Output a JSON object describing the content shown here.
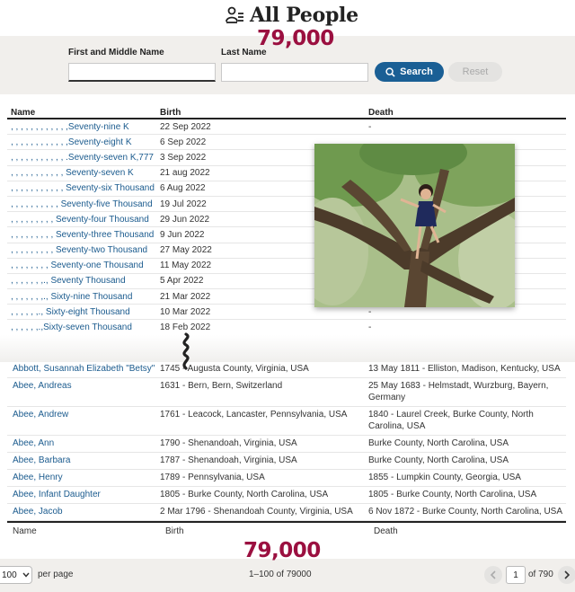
{
  "header": {
    "title": "All People"
  },
  "overlay_counts": {
    "top": "79,000",
    "bottom": "79,000"
  },
  "search": {
    "first_label": "First and Middle Name",
    "last_label": "Last Name",
    "first_value": "",
    "last_value": "",
    "search_label": "Search",
    "reset_label": "Reset"
  },
  "table_top": {
    "headers": {
      "name": "Name",
      "birth": "Birth",
      "death": "Death"
    },
    "rows": [
      {
        "name": ", , , , , , , , , , , ,Seventy-nine K",
        "birth": "22 Sep 2022",
        "death": "-"
      },
      {
        "name": ", , , , , , , , , , , ,Seventy-eight K",
        "birth": "6 Sep 2022",
        "death": ""
      },
      {
        "name": ", , , , , , , , , , , .Seventy-seven K,777",
        "birth": "3 Sep 2022",
        "death": ""
      },
      {
        "name": ", , , , , , , , , , , Seventy-seven K",
        "birth": "21 aug 2022",
        "death": ""
      },
      {
        "name": ", , , , , , , , , , , Seventy-six Thousand",
        "birth": "6 Aug 2022",
        "death": ""
      },
      {
        "name": ", , , , , , , , , , Seventy-five Thousand",
        "birth": "19 Jul 2022",
        "death": ""
      },
      {
        "name": ", , , , , , , , , Seventy-four Thousand",
        "birth": "29 Jun 2022",
        "death": ""
      },
      {
        "name": ", , , , , , , , , Seventy-three Thousand",
        "birth": "9 Jun 2022",
        "death": ""
      },
      {
        "name": ", , , , , , , , , Seventy-two Thousand",
        "birth": "27 May 2022",
        "death": ""
      },
      {
        "name": ", , , , , , , , Seventy-one Thousand",
        "birth": "11 May 2022",
        "death": ""
      },
      {
        "name": ", , , , , , ,., Seventy Thousand",
        "birth": "5 Apr 2022",
        "death": ""
      },
      {
        "name": ", , , , , , ,., Sixty-nine Thousand",
        "birth": "21 Mar 2022",
        "death": ""
      },
      {
        "name": ", , , , , ,., Sixty-eight Thousand",
        "birth": "10 Mar 2022",
        "death": "-"
      },
      {
        "name": ", , , , , ,.,Sixty-seven Thousand",
        "birth": "18 Feb 2022",
        "death": "-"
      }
    ]
  },
  "table_bottom": {
    "rows": [
      {
        "name": "Abbott, Susannah Elizabeth \"Betsy\"",
        "birth": "1745 - Augusta County, Virginia, USA",
        "death": "13 May 1811 - Elliston, Madison, Kentucky, USA"
      },
      {
        "name": "Abee, Andreas",
        "birth": "1631 - Bern, Bern, Switzerland",
        "death": "25 May 1683 - Helmstadt, Wurzburg, Bayern, Germany"
      },
      {
        "name": "Abee, Andrew",
        "birth": "1761 - Leacock, Lancaster, Pennsylvania, USA",
        "death": "1840 - Laurel Creek, Burke County, North Carolina, USA"
      },
      {
        "name": "Abee, Ann",
        "birth": "1790 - Shenandoah, Virginia, USA",
        "death": "Burke County, North Carolina, USA"
      },
      {
        "name": "Abee, Barbara",
        "birth": "1787 - Shenandoah, Virginia, USA",
        "death": "Burke County, North Carolina, USA"
      },
      {
        "name": "Abee, Henry",
        "birth": "1789 - Pennsylvania, USA",
        "death": "1855 - Lumpkin County, Georgia, USA"
      },
      {
        "name": "Abee, Infant Daughter",
        "birth": "1805 - Burke County, North Carolina, USA",
        "death": "1805 - Burke County, North Carolina, USA"
      },
      {
        "name": "Abee, Jacob",
        "birth": "2 Mar 1796 - Shenandoah County, Virginia, USA",
        "death": "6 Nov 1872 - Burke County, North Carolina, USA"
      }
    ],
    "footer_headers": {
      "name": "Name",
      "birth": "Birth",
      "death": "Death"
    }
  },
  "footer": {
    "per_page_value": "100",
    "per_page_label": "per page",
    "range": "1–100 of 79000",
    "page_value": "1",
    "page_of": "of 790"
  },
  "colors": {
    "accent": "#1a5f95",
    "count_overlay": "#9b1040",
    "link": "#1b5b8e"
  }
}
